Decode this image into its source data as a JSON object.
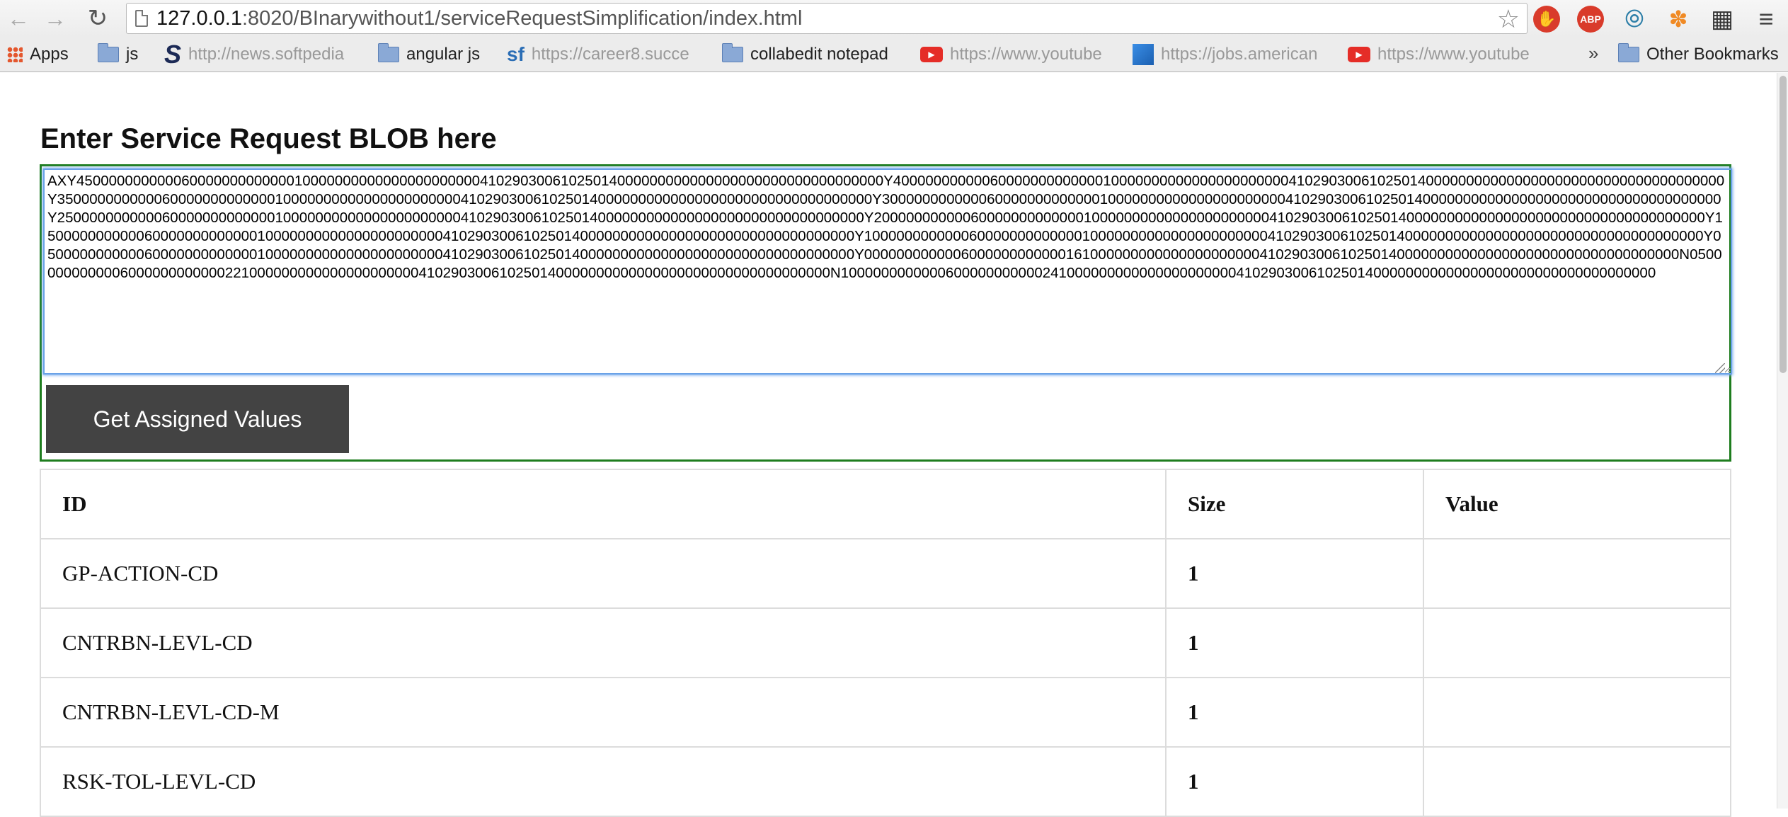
{
  "browser": {
    "url_host": "127.0.0.1",
    "url_path": ":8020/BInarywithout1/serviceRequestSimplification/index.html",
    "extensions": [
      "stop-icon",
      "abp-icon",
      "wave-icon",
      "bird-icon",
      "film-icon"
    ]
  },
  "bookmarks": {
    "apps": "Apps",
    "js": "js",
    "softpedia": "http://news.softpedia",
    "angular": "angular js",
    "career": "https://career8.succe",
    "collabedit": "collabedit notepad",
    "youtube1": "https://www.youtube",
    "jobs": "https://jobs.american",
    "youtube2": "https://www.youtube",
    "overflow": "»",
    "other": "Other Bookmarks"
  },
  "page": {
    "heading": "Enter Service Request BLOB here",
    "blob": "AXY4500000000000600000000000001000000000000000000000041029030061025014000000000000000000000000000000000Y4000000000006000000000000010000000000000000000000410290300610250140000000000000000000000000000000000000Y35000000000006000000000000010000000000000000000000410290300610250140000000000000000000000000000000000Y30000000000006000000000000010000000000000000000000410290300610250140000000000000000000000000000000000000Y2500000000000600000000000001000000000000000000000041029030061025014000000000000000000000000000000000Y2000000000006000000000000010000000000000000000000410290300610250140000000000000000000000000000000000000Y15000000000006000000000000010000000000000000000000410290300610250140000000000000000000000000000000000Y10000000000006000000000000010000000000000000000000410290300610250140000000000000000000000000000000000000Y05000000000006000000000000010000000000000000000000410290300610250140000000000000000000000000000000000Y00000000000060000000000001610000000000000000000004102903006102501400000000000000000000000000000000000N05000000000006000000000000221000000000000000000000410290300610250140000000000000000000000000000000000N10000000000006000000000002410000000000000000000004102903006102501400000000000000000000000000000000000",
    "button": "Get Assigned Values"
  },
  "table": {
    "headers": {
      "id": "ID",
      "size": "Size",
      "value": "Value"
    },
    "rows": [
      {
        "id": "GP-ACTION-CD",
        "size": "1",
        "value": ""
      },
      {
        "id": "CNTRBN-LEVL-CD",
        "size": "1",
        "value": ""
      },
      {
        "id": "CNTRBN-LEVL-CD-M",
        "size": "1",
        "value": ""
      },
      {
        "id": "RSK-TOL-LEVL-CD",
        "size": "1",
        "value": ""
      }
    ]
  }
}
